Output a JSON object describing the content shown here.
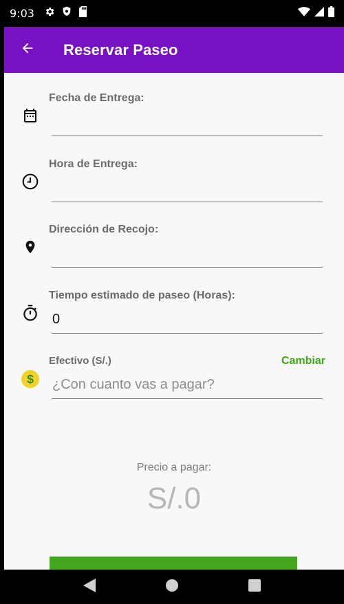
{
  "status_bar": {
    "time": "9:03",
    "icons": [
      "gear-icon",
      "shield-icon",
      "sd-card-icon",
      "wifi-icon",
      "signal-icon",
      "battery-icon"
    ]
  },
  "app_bar": {
    "title": "Reservar Paseo",
    "back_icon": "arrow-left-icon",
    "color": "#7711c1"
  },
  "form": {
    "delivery_date": {
      "label": "Fecha de Entrega:",
      "value": "",
      "icon": "calendar-icon"
    },
    "delivery_time": {
      "label": "Hora de Entrega:",
      "value": "",
      "icon": "clock-icon"
    },
    "pickup_address": {
      "label": "Dirección de Recojo:",
      "value": "",
      "icon": "location-pin-icon"
    },
    "walk_time": {
      "label": "Tiempo estimado de paseo (Horas):",
      "value": "0",
      "icon": "stopwatch-icon"
    },
    "payment": {
      "label": "Efectivo (S/.)",
      "change_label": "Cambiar",
      "placeholder": "¿Con cuanto vas a pagar?",
      "value": "",
      "icon": "dollar-coin-icon",
      "accent": "#3fa51a"
    }
  },
  "price": {
    "label": "Precio a pagar:",
    "value": "S/.0"
  },
  "submit_button": {
    "color": "#43a71d"
  },
  "nav_bar": {
    "icons": [
      "back-triangle-icon",
      "home-circle-icon",
      "recents-square-icon"
    ]
  }
}
